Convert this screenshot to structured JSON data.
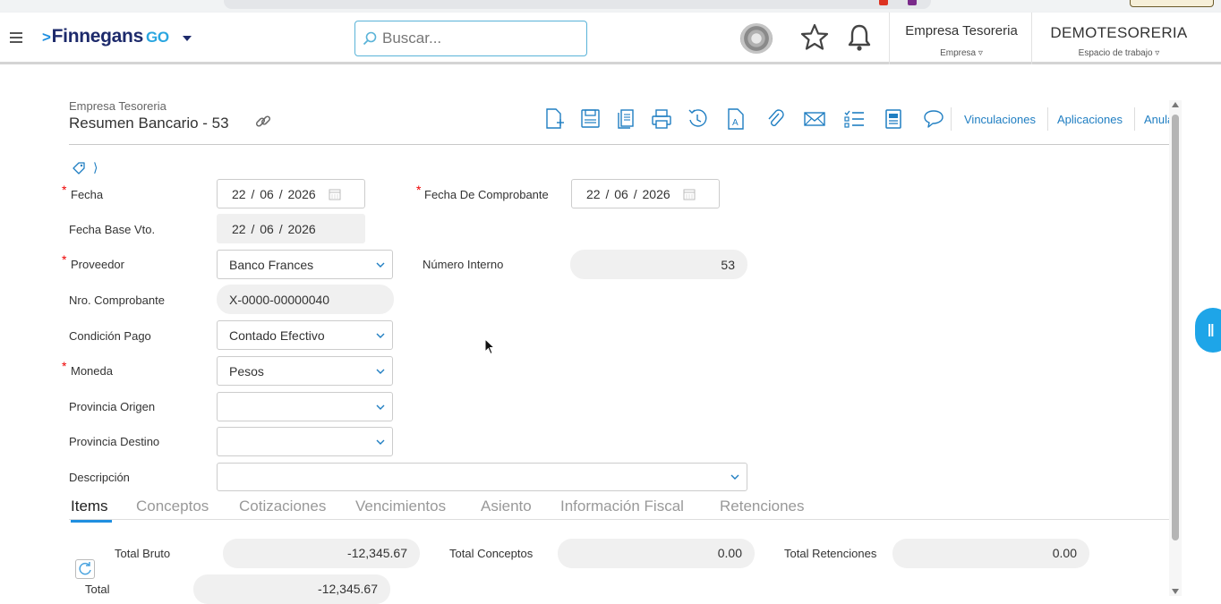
{
  "app": {
    "brand": "Finnegans",
    "brand_suffix": "GO",
    "search_placeholder": "Buscar...",
    "company": {
      "name": "Empresa Tesoreria",
      "label": "Empresa"
    },
    "workspace": {
      "name": "DEMOTESORERIA",
      "label": "Espacio de trabajo"
    }
  },
  "page": {
    "company": "Empresa Tesoreria",
    "title": "Resumen Bancario - 53"
  },
  "toolbar": {
    "icons": [
      "new-document-icon",
      "save-icon",
      "copy-icon",
      "print-icon",
      "history-icon",
      "document-a-icon",
      "attach-icon",
      "email-icon",
      "checklist-icon",
      "report-icon",
      "comment-icon"
    ],
    "links": [
      "Vinculaciones",
      "Aplicaciones",
      "Anular"
    ]
  },
  "form": {
    "fecha": {
      "label": "Fecha",
      "day": "22",
      "month": "06",
      "year": "2026"
    },
    "fecha_comprobante": {
      "label": "Fecha De Comprobante",
      "day": "22",
      "month": "06",
      "year": "2026"
    },
    "fecha_base_vto": {
      "label": "Fecha Base Vto.",
      "day": "22",
      "month": "06",
      "year": "2026"
    },
    "proveedor": {
      "label": "Proveedor",
      "value": "Banco Frances"
    },
    "numero_interno": {
      "label": "Número Interno",
      "value": "53"
    },
    "nro_comprobante": {
      "label": "Nro. Comprobante",
      "value": "X-0000-00000040"
    },
    "condicion_pago": {
      "label": "Condición Pago",
      "value": "Contado Efectivo"
    },
    "moneda": {
      "label": "Moneda",
      "value": "Pesos"
    },
    "provincia_origen": {
      "label": "Provincia Origen",
      "value": ""
    },
    "provincia_destino": {
      "label": "Provincia Destino",
      "value": ""
    },
    "descripcion": {
      "label": "Descripción",
      "value": ""
    }
  },
  "tabs": [
    "Items",
    "Conceptos",
    "Cotizaciones",
    "Vencimientos",
    "Asiento",
    "Información Fiscal",
    "Retenciones"
  ],
  "active_tab": "Items",
  "totals": {
    "total_bruto": {
      "label": "Total Bruto",
      "value": "-12,345.67"
    },
    "total_conceptos": {
      "label": "Total Conceptos",
      "value": "0.00"
    },
    "total_retenciones": {
      "label": "Total Retenciones",
      "value": "0.00"
    },
    "total": {
      "label": "Total",
      "value": "-12,345.67"
    }
  },
  "colors": {
    "accent": "#1f8fe0",
    "link": "#1f7ec2",
    "required": "#e00000",
    "brand_navy": "#1d2a6b",
    "side_handle": "#1ea5e8"
  }
}
